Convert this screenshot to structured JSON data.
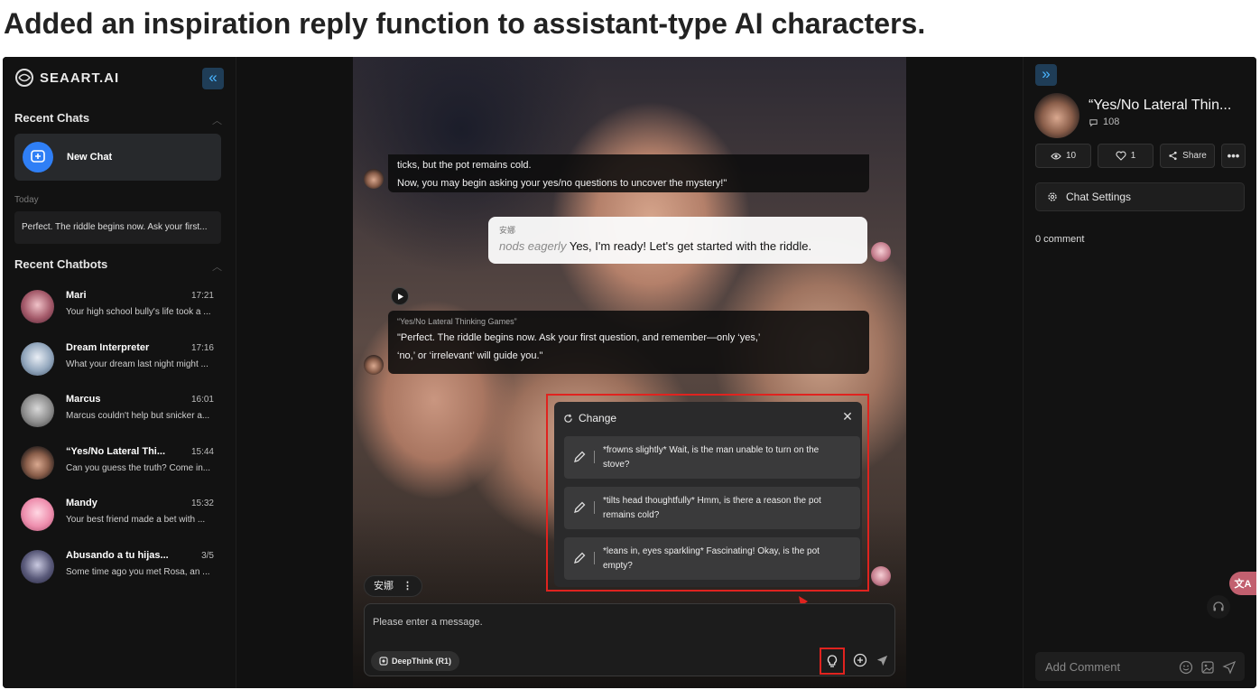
{
  "headline": "Added an inspiration reply function to assistant-type AI characters.",
  "sidebar": {
    "brand": "SEAART.AI",
    "recent_chats_title": "Recent Chats",
    "new_chat_label": "New Chat",
    "today_label": "Today",
    "recent_item": "Perfect. The riddle begins now. Ask your first...",
    "recent_chatbots_title": "Recent Chatbots",
    "chatbots": [
      {
        "name": "Mari",
        "time": "17:21",
        "preview": "Your high school bully's life took a ..."
      },
      {
        "name": "Dream Interpreter",
        "time": "17:16",
        "preview": "What your dream last night might ..."
      },
      {
        "name": "Marcus",
        "time": "16:01",
        "preview": "Marcus couldn't help but snicker a..."
      },
      {
        "name": "“Yes/No Lateral Thi...",
        "time": "15:44",
        "preview": "Can you guess the truth? Come in..."
      },
      {
        "name": "Mandy",
        "time": "15:32",
        "preview": "Your best friend made a bet with ..."
      },
      {
        "name": "Abusando a tu hijas...",
        "time": "3/5",
        "preview": "Some time ago you met Rosa, an ..."
      }
    ]
  },
  "chat": {
    "msg1_line1": "ticks, but the pot remains cold.",
    "msg1_line2": "Now, you may begin asking your yes/no questions to uncover the mystery!\"",
    "user_name": "安娜",
    "user_action": "nods eagerly",
    "user_text": "Yes, I'm ready! Let's get started with the riddle.",
    "bot_label": "“Yes/No Lateral Thinking Games”",
    "bot_line1": "\"Perfect. The riddle begins now. Ask your first question, and remember—only ‘yes,’",
    "bot_line2": "‘no,’ or ‘irrelevant’ will guide you.\"",
    "popup_title": "Change",
    "options": [
      "*frowns slightly* Wait, is the man unable to turn on the stove?",
      "*tilts head thoughtfully* Hmm, is there a reason the pot remains cold?",
      "*leans in, eyes sparkling* Fascinating! Okay, is the pot empty?"
    ],
    "persona_label": "安娜",
    "input_placeholder": "Please enter a message.",
    "deepthink_label": "DeepThink (R1)"
  },
  "right": {
    "title": "“Yes/No Lateral Thin...",
    "chat_count": "108",
    "views": "10",
    "likes": "1",
    "share_label": "Share",
    "settings_label": "Chat Settings",
    "comments_label": "0 comment",
    "comment_placeholder": "Add Comment"
  },
  "colors": {
    "accent_blue": "#2f7ff6",
    "highlight_red": "#e0231f"
  }
}
